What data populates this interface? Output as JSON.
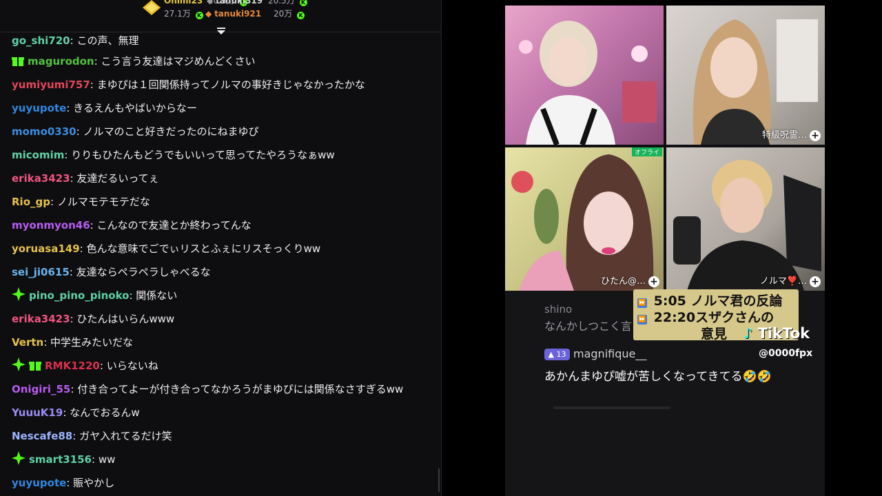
{
  "leaderboard": {
    "entries": [
      {
        "name": "Onimi23",
        "amount": "20.5万",
        "color": "#e6c93b"
      },
      {
        "name": "tanuki319",
        "amount": "20.5万",
        "color": "#d9d9d9"
      },
      {
        "name": "",
        "amount": "27.1万",
        "color": "#adadb8"
      },
      {
        "name": "tanuki921",
        "amount": "20万",
        "color": "#e8893a"
      }
    ],
    "k_badge": "K"
  },
  "chat": {
    "messages": [
      {
        "user": "go_shi720",
        "text": "この声、無理",
        "color": "#5fd3a6",
        "badges": []
      },
      {
        "user": "magurodon",
        "text": "こう言う友達はマジめんどくさい",
        "color": "#52c33f",
        "badges": [
          "gift"
        ]
      },
      {
        "user": "yumiyumi757",
        "text": "まゆぴは１回関係持ってノルマの事好きじゃなかったかな",
        "color": "#e0475a",
        "badges": []
      },
      {
        "user": "yuyupote",
        "text": "きるえんもやばいからなー",
        "color": "#2f87e0",
        "badges": []
      },
      {
        "user": "momo0330",
        "text": "ノルマのこと好きだったのにねまゆぴ",
        "color": "#3c8de0",
        "badges": []
      },
      {
        "user": "micomim",
        "text": "りりもひたんもどうでもいいって思ってたやろうなぁww",
        "color": "#5fd3a6",
        "badges": []
      },
      {
        "user": "erika3423",
        "text": "友達だるいってぇ",
        "color": "#f0557f",
        "badges": []
      },
      {
        "user": "Rio_gp",
        "text": "ノルマモテモテだな",
        "color": "#e6c14a",
        "badges": []
      },
      {
        "user": "myonmyon46",
        "text": "こんなので友達とか終わってんな",
        "color": "#b75cf0",
        "badges": []
      },
      {
        "user": "yoruasa149",
        "text": "色んな意味でごでぃリスとふぇにリスそっくりww",
        "color": "#e6c14a",
        "badges": []
      },
      {
        "user": "sei_ji0615",
        "text": "友達ならペラペラしゃべるな",
        "color": "#68b5f0",
        "badges": []
      },
      {
        "user": "pino_pino_pinoko",
        "text": "関係ない",
        "color": "#5fd3a6",
        "badges": [
          "sparkle"
        ]
      },
      {
        "user": "erika3423",
        "text": "ひたんはいらんwww",
        "color": "#f0557f",
        "badges": []
      },
      {
        "user": "Vertn",
        "text": "中学生みたいだな",
        "color": "#e6c14a",
        "badges": []
      },
      {
        "user": "RMK1220",
        "text": "いらないね",
        "color": "#d9304c",
        "badges": [
          "sparkle",
          "gift"
        ]
      },
      {
        "user": "Onigiri_55",
        "text": "付き合ってよーが付き合ってなかろうがまゆぴには関係なさすぎるww",
        "color": "#b75cf0",
        "badges": []
      },
      {
        "user": "YuuuK19",
        "text": "なんでおるんw",
        "color": "#9a8cf2",
        "badges": []
      },
      {
        "user": "Nescafe88",
        "text": "ガヤ入れてるだけ笑",
        "color": "#9ab4ff",
        "badges": []
      },
      {
        "user": "smart3156",
        "text": "ww",
        "color": "#5fd3a6",
        "badges": [
          "sparkle"
        ]
      },
      {
        "user": "yuyupote",
        "text": "賑やかし",
        "color": "#2f87e0",
        "badges": []
      }
    ]
  },
  "video": {
    "tiles": [
      {
        "label": ""
      },
      {
        "label": "特級呪霊…"
      },
      {
        "label": "ひたん@…"
      },
      {
        "label": "ノルマ❣️…"
      }
    ],
    "top_right_tag": "オフライ",
    "ghost_user": "shino",
    "ghost_msg": "なんかしつこく言うね台上",
    "caption_line1": "5:05 ノルマ君の反論",
    "caption_line2": "22:20スザクさんの",
    "caption_line3": "意見",
    "tiktok_text": "TikTok",
    "tiktok_handle": "@0000fpx",
    "comment_level": "13",
    "comment_user": "magnifique__",
    "comment_text": "あかんまゆぴ嘘が苦しくなってきてる🤣🤣"
  }
}
